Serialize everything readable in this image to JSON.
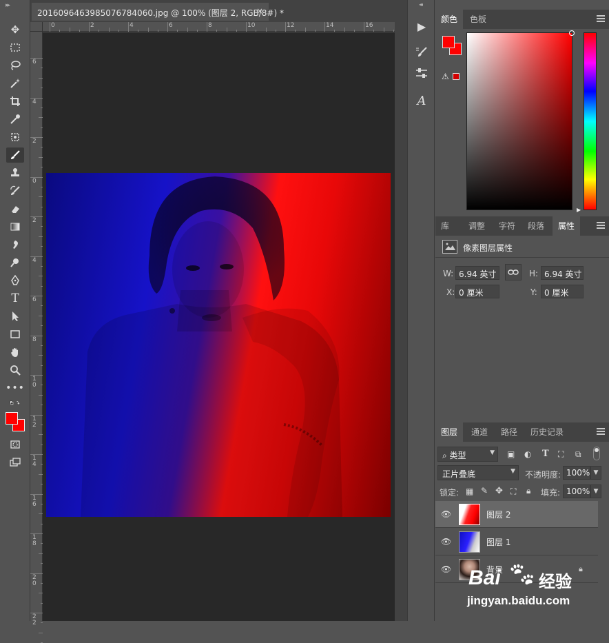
{
  "document": {
    "tab_title": "20160964639850767840​60.jpg @ 100% (图层 2, RGB/8#) *",
    "close_glyph": "×",
    "ruler_h_labels": [
      "0",
      "2",
      "4",
      "6",
      "8",
      "10",
      "12",
      "14",
      "16"
    ],
    "ruler_v_labels": [
      "6",
      "4",
      "2",
      "0",
      "2",
      "4",
      "6",
      "8",
      "1 0",
      "1 2",
      "1 4",
      "1 6",
      "1 8",
      "2 0",
      "2 2"
    ]
  },
  "toolbar": {
    "tools": [
      "move-tool",
      "marquee-tool",
      "lasso-tool",
      "magic-wand-tool",
      "crop-tool",
      "eyedropper-tool",
      "patch-tool",
      "brush-tool",
      "stamp-tool",
      "history-brush-tool",
      "eraser-tool",
      "gradient-tool",
      "smudge-tool",
      "dodge-tool",
      "pen-tool",
      "type-tool",
      "path-select-tool",
      "rectangle-tool",
      "hand-tool",
      "zoom-tool",
      "more-tools"
    ],
    "selected": "brush-tool",
    "foreground_color": "#ff0000",
    "background_color": "#ff0000"
  },
  "color_panel": {
    "tabs": [
      "颜色",
      "色板"
    ],
    "active_tab": "颜色",
    "foreground_color": "#ff0000",
    "background_color": "#ff0000"
  },
  "properties_panel": {
    "tabs": [
      "库",
      "调整",
      "字符",
      "段落",
      "属性"
    ],
    "active_tab": "属性",
    "header": "像素图层属性",
    "w_label": "W:",
    "w_value": "6.94 英寸",
    "h_label": "H:",
    "h_value": "6.94 英寸",
    "x_label": "X:",
    "x_value": "0 厘米",
    "y_label": "Y:",
    "y_value": "0 厘米"
  },
  "layers_panel": {
    "tabs": [
      "图层",
      "通道",
      "路径",
      "历史记录"
    ],
    "active_tab": "图层",
    "filter_label": "类型",
    "blend_mode": "正片叠底",
    "opacity_label": "不透明度:",
    "opacity_value": "100%",
    "lock_label": "锁定:",
    "fill_label": "填充:",
    "fill_value": "100%",
    "layers": [
      {
        "name": "图层 2",
        "selected": true
      },
      {
        "name": "图层 1",
        "selected": false
      },
      {
        "name": "背景",
        "selected": false,
        "locked": true
      }
    ]
  },
  "watermark": {
    "brand": "Bai",
    "brand_tail": "经验",
    "url": "jingyan.baidu.com"
  }
}
